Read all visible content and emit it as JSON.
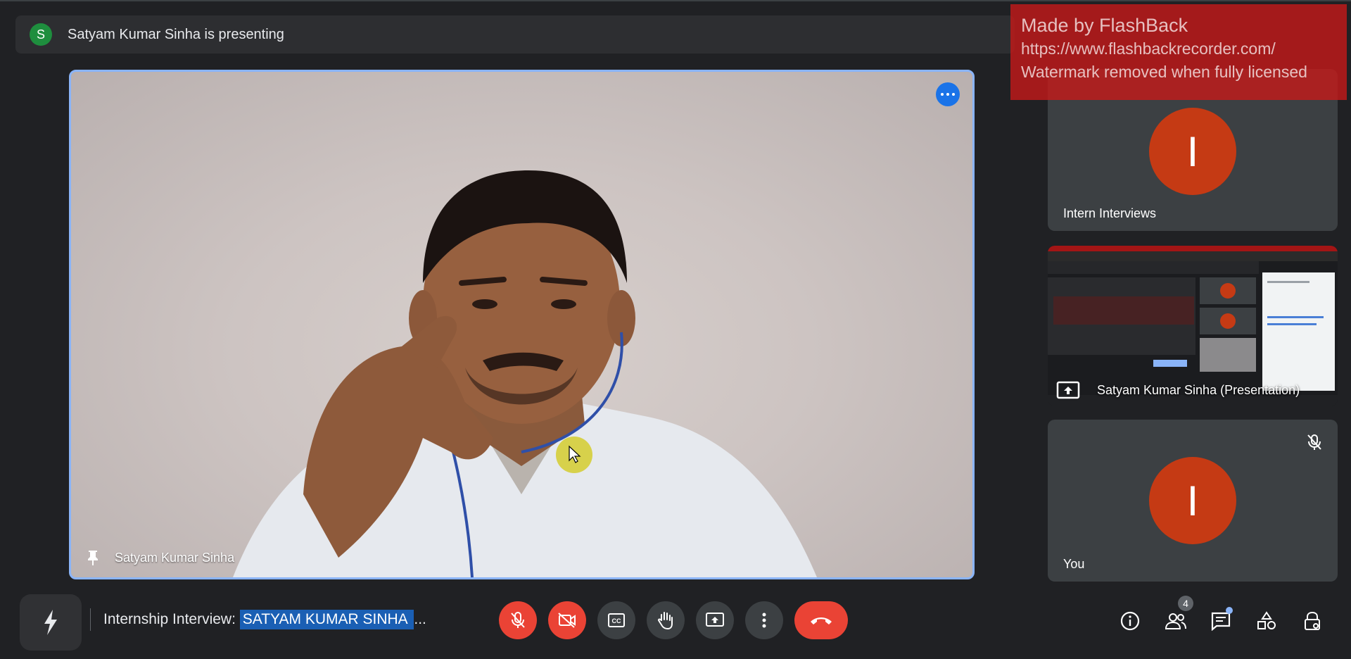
{
  "presenting": {
    "avatar_letter": "S",
    "text": "Satyam Kumar Sinha is presenting"
  },
  "main_video": {
    "name": "Satyam Kumar Sinha"
  },
  "side_tiles": [
    {
      "name": "Intern Interviews",
      "avatar_letter": "I"
    },
    {
      "name": "Satyam Kumar Sinha (Presentation)"
    },
    {
      "name": "You",
      "avatar_letter": "I"
    }
  ],
  "watermark": {
    "line1": "Made by FlashBack",
    "line2": "https://www.flashbackrecorder.com/",
    "line3": "Watermark removed when fully licensed"
  },
  "meeting": {
    "title_prefix": "Internship Interview: ",
    "title_highlight": "SATYAM KUMAR SINHA ",
    "title_ellipsis": "..."
  },
  "controls": {
    "people_count": "4"
  },
  "colors": {
    "background": "#202124",
    "accent_blue": "#8ab4f8",
    "danger_red": "#ea4335",
    "avatar_orange": "#c53a14",
    "watermark_red": "#c91818"
  },
  "icons": [
    "pin-icon",
    "more-options-icon",
    "mic-off-icon",
    "camera-off-icon",
    "captions-icon",
    "raise-hand-icon",
    "present-screen-icon",
    "more-vert-icon",
    "end-call-icon",
    "info-icon",
    "people-icon",
    "chat-icon",
    "activities-icon",
    "host-controls-icon"
  ]
}
